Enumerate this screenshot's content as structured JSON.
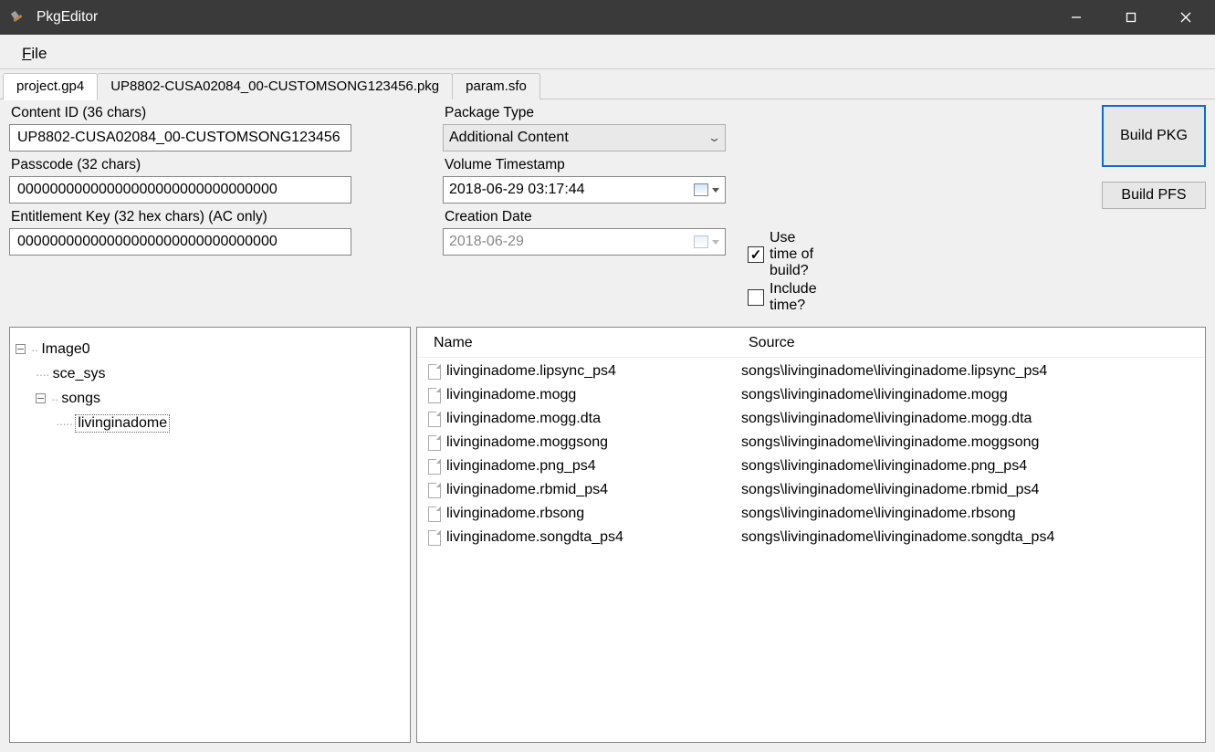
{
  "window": {
    "title": "PkgEditor"
  },
  "menu": {
    "file_html": "File",
    "file_underline": "F"
  },
  "tabs": [
    {
      "label": "project.gp4",
      "active": true
    },
    {
      "label": "UP8802-CUSA02084_00-CUSTOMSONG123456.pkg",
      "active": false
    },
    {
      "label": "param.sfo",
      "active": false
    }
  ],
  "form": {
    "content_id_label": "Content ID (36 chars)",
    "content_id_value": "UP8802-CUSA02084_00-CUSTOMSONG123456",
    "passcode_label": "Passcode (32 chars)",
    "passcode_value": "00000000000000000000000000000000",
    "ent_label": "Entitlement Key (32 hex chars) (AC only)",
    "ent_value": "00000000000000000000000000000000",
    "pkg_type_label": "Package Type",
    "pkg_type_value": "Additional Content",
    "vol_ts_label": "Volume Timestamp",
    "vol_ts_value": "2018-06-29 03:17:44",
    "creation_label": "Creation Date",
    "creation_value": "2018-06-29",
    "use_time_label": "Use time of build?",
    "use_time_checked": true,
    "include_time_label": "Include time?",
    "include_time_checked": false
  },
  "buttons": {
    "build_pkg": "Build PKG",
    "build_pfs": "Build PFS"
  },
  "tree": {
    "root": "Image0",
    "n1": "sce_sys",
    "n2": "songs",
    "n2a": "livinginadome"
  },
  "list": {
    "header_name": "Name",
    "header_source": "Source",
    "rows": [
      {
        "name": "livinginadome.lipsync_ps4",
        "source": "songs\\livinginadome\\livinginadome.lipsync_ps4"
      },
      {
        "name": "livinginadome.mogg",
        "source": "songs\\livinginadome\\livinginadome.mogg"
      },
      {
        "name": "livinginadome.mogg.dta",
        "source": "songs\\livinginadome\\livinginadome.mogg.dta"
      },
      {
        "name": "livinginadome.moggsong",
        "source": "songs\\livinginadome\\livinginadome.moggsong"
      },
      {
        "name": "livinginadome.png_ps4",
        "source": "songs\\livinginadome\\livinginadome.png_ps4"
      },
      {
        "name": "livinginadome.rbmid_ps4",
        "source": "songs\\livinginadome\\livinginadome.rbmid_ps4"
      },
      {
        "name": "livinginadome.rbsong",
        "source": "songs\\livinginadome\\livinginadome.rbsong"
      },
      {
        "name": "livinginadome.songdta_ps4",
        "source": "songs\\livinginadome\\livinginadome.songdta_ps4"
      }
    ]
  }
}
